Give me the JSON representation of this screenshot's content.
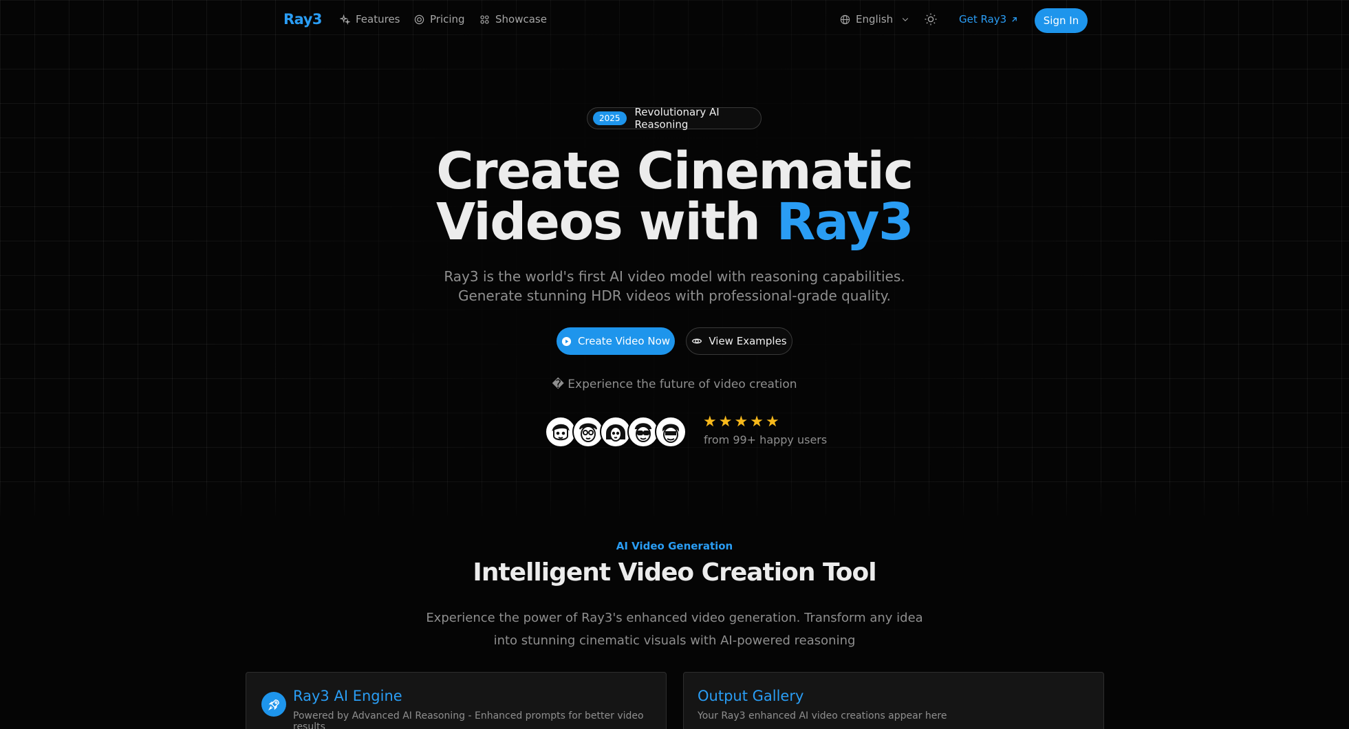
{
  "nav": {
    "logo": "Ray3",
    "links": [
      {
        "label": "Features",
        "icon": "sparkles-icon"
      },
      {
        "label": "Pricing",
        "icon": "coin-icon"
      },
      {
        "label": "Showcase",
        "icon": "grid-icon"
      }
    ],
    "language": "English",
    "get_ray": "Get Ray3",
    "sign_in": "Sign In"
  },
  "hero": {
    "badge_year": "2025",
    "badge_text": "Revolutionary AI Reasoning",
    "title_line1": "Create Cinematic",
    "title_line2_prefix": "Videos with ",
    "title_accent": "Ray3",
    "subtitle_line1": "Ray3 is the world's first AI video model with reasoning capabilities.",
    "subtitle_line2": "Generate stunning HDR videos with professional-grade quality.",
    "primary_button": "Create Video Now",
    "secondary_button": "View Examples",
    "experience": "� Experience the future of video creation",
    "rating_stars": 5,
    "happy_users": "from 99+ happy users"
  },
  "section": {
    "tag": "AI Video Generation",
    "title": "Intelligent Video Creation Tool",
    "desc_line1": "Experience the power of Ray3's enhanced video generation. Transform any idea",
    "desc_line2": "into stunning cinematic visuals with AI-powered reasoning"
  },
  "cards": [
    {
      "title": "Ray3 AI Engine",
      "subtitle": "Powered by Advanced AI Reasoning - Enhanced prompts for better video results",
      "icon": "rocket-icon"
    },
    {
      "title": "Output Gallery",
      "subtitle": "Your Ray3 enhanced AI video creations appear here"
    }
  ],
  "colors": {
    "accent": "#1e95ec",
    "star": "#f7b91c",
    "background": "#050505"
  }
}
